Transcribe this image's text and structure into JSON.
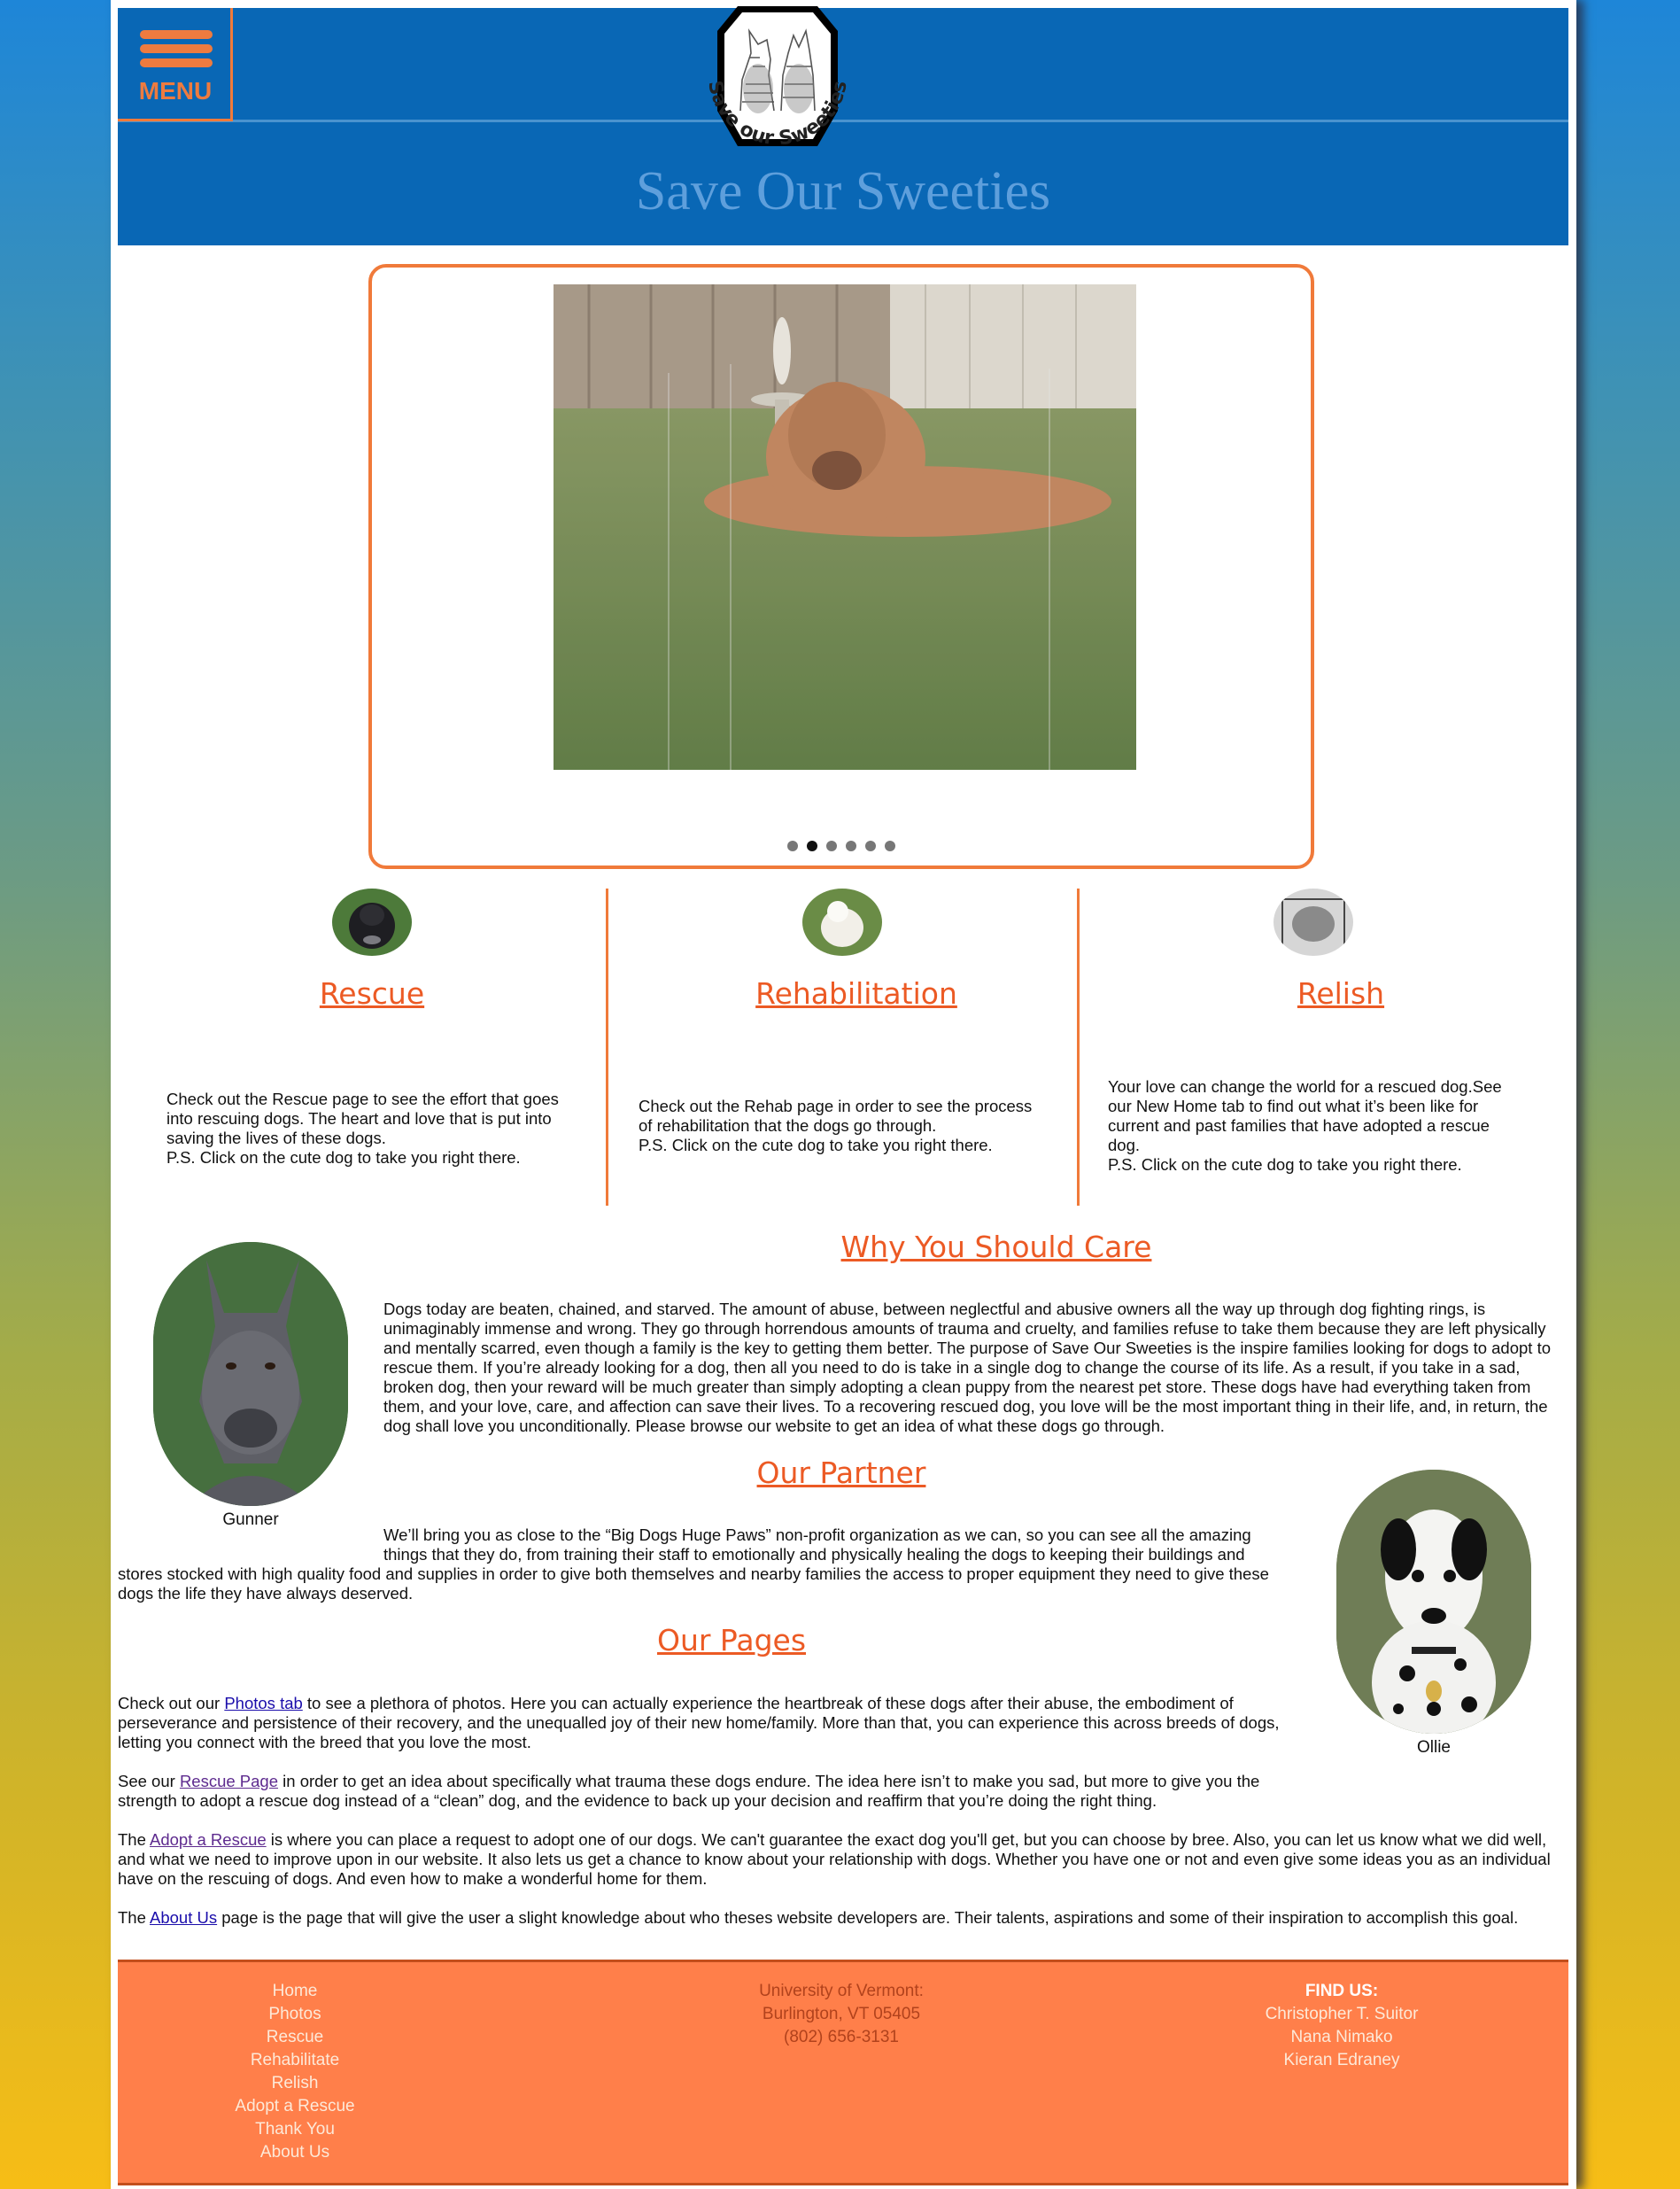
{
  "header": {
    "menu_label": "MENU",
    "logo_text": "Save our Sweeties",
    "site_title": "Save Our Sweeties"
  },
  "slideshow": {
    "dots": 6,
    "active_index": 1
  },
  "features": [
    {
      "title": "Rescue",
      "text": [
        "Check out the Rescue page to see the effort that goes",
        "into rescuing dogs. The heart and love that is put into",
        "saving the lives of these dogs.",
        "P.S. Click on the cute dog to take you right there."
      ]
    },
    {
      "title": "Rehabilitation",
      "text": [
        "Check out the Rehab page in order to see the process",
        "of rehabilitation that the dogs go through.",
        "P.S. Click on the cute dog to take you right there."
      ]
    },
    {
      "title": "Relish",
      "text": [
        "Your love can change the world for a rescued dog.See",
        "our New Home tab to find out what it’s been like for",
        "current and past families that have adopted a rescue",
        "dog.",
        "P.S. Click on the cute dog to take you right there."
      ]
    }
  ],
  "why": {
    "title": "Why You Should Care",
    "lines": [
      "Dogs today are beaten, chained, and starved. The amount of abuse, between neglectful and abusive owners all the way up through dog fighting rings, is",
      "unimaginably immense and wrong. They go through horrendous amounts of trauma and cruelty, and families refuse to take them because they are left physically",
      "and mentally scarred, even though a family is the key to getting them better. The purpose of Save Our Sweeties is the inspire families looking for dogs to adopt to",
      "rescue them. If you’re already looking for a dog, then all you need to do is take in a single dog to change the course of its life. As a result, if you take in a sad,",
      "broken dog, then your reward will be much greater than simply adopting a clean puppy from the nearest pet store. These dogs have had everything taken from",
      "them, and your love, care, and affection can save their lives. To a recovering rescued dog, you love will be the most important thing in their life, and, in return, the",
      "dog shall love you unconditionally. Please browse our website to get an idea of what these dogs go through."
    ]
  },
  "dogs": {
    "left_caption": "Gunner",
    "right_caption": "Ollie"
  },
  "partner": {
    "title": "Our Partner",
    "lines": [
      "We’ll bring you as close to the “Big Dogs Huge Paws” non-profit organization as we can, so you can see all the amazing",
      "things that they do, from training their staff to emotionally and physically healing the dogs to keeping their buildings and",
      "stores stocked with high quality food and supplies in order to give both themselves and nearby families the access to proper equipment they need to give these",
      "dogs the life they have always deserved."
    ]
  },
  "pages": {
    "title": "Our Pages",
    "p1": {
      "pre": "Check out our ",
      "link": "Photos tab",
      "line1_post": " to see a plethora of photos. Here you can actually experience the heartbreak of these dogs after their abuse, the embodiment of",
      "line2": "perseverance and persistence of their recovery, and the unequalled joy of their new home/family. More than that, you can experience this across breeds of dogs,",
      "line3": "letting you connect with the breed that you love the most."
    },
    "p2": {
      "pre": "See our ",
      "link": "Rescue Page",
      "line1_post": " in order to get an idea about specifically what trauma these dogs endure. The idea here isn’t to make you sad, but more to give you the",
      "line2": "strength to adopt a rescue dog instead of a “clean” dog, and the evidence to back up your decision and reaffirm that you’re doing the right thing."
    },
    "p3": {
      "pre": "The ",
      "link": "Adopt a Rescue",
      "line1_post": " is where you can place a request to adopt one of our dogs. We can't guarantee the exact dog you'll get, but you can choose by bree. Also, you can let us know what we did well,",
      "line2": "and what we need to improve upon in our website. It also lets us get a chance to know about your relationship with dogs. Whether you have one or not and even give some ideas you as an individual",
      "line3": "have on the rescuing of dogs. And even how to make a wonderful home for them."
    },
    "p4": {
      "pre": "The ",
      "link": "About Us",
      "line1_post": " page is the page that will give the user a slight knowledge about who theses website developers are. Their talents, aspirations and some of their inspiration to accomplish this goal."
    }
  },
  "footer": {
    "nav": [
      "Home",
      "Photos",
      "Rescue",
      "Rehabilitate",
      "Relish",
      "Adopt a Rescue",
      "Thank You",
      "About Us"
    ],
    "address": [
      "University of Vermont:",
      "Burlington, VT 05405",
      "(802) 656-3131"
    ],
    "find_us": {
      "heading": "FIND US:",
      "names": [
        "Christopher T. Suitor",
        "Nana Nimako",
        "Kieran Edraney"
      ]
    }
  },
  "colors": {
    "header_blue": "#0967b5",
    "accent_orange": "#f07a3a",
    "title_orange": "#ec5a24",
    "footer_orange": "#ff7f4a"
  }
}
